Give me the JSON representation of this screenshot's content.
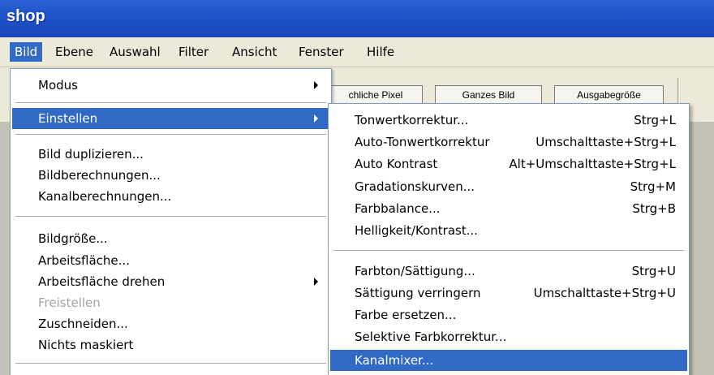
{
  "window": {
    "title": "shop"
  },
  "menubar": [
    {
      "label": "Bild",
      "active": true
    },
    {
      "label": "Ebene"
    },
    {
      "label": "Auswahl"
    },
    {
      "label": "Filter"
    },
    {
      "label": "Ansicht"
    },
    {
      "label": "Fenster"
    },
    {
      "label": "Hilfe"
    }
  ],
  "options_bar": {
    "buttons": [
      "chliche Pixel",
      "Ganzes Bild",
      "Ausgabegröße"
    ]
  },
  "bild_menu": {
    "items": [
      {
        "label": "Modus",
        "submenu": true
      },
      {
        "label": "Einstellen",
        "submenu": true,
        "selected": true
      },
      {
        "label": "Bild duplizieren..."
      },
      {
        "label": "Bildberechnungen..."
      },
      {
        "label": "Kanalberechnungen..."
      },
      {
        "label": "Bildgröße..."
      },
      {
        "label": "Arbeitsfläche..."
      },
      {
        "label": "Arbeitsfläche drehen",
        "submenu": true
      },
      {
        "label": "Freistellen",
        "disabled": true
      },
      {
        "label": "Zuschneiden..."
      },
      {
        "label": "Nichts maskiert"
      }
    ]
  },
  "einstellen_menu": {
    "items": [
      {
        "label": "Tonwertkorrektur...",
        "shortcut": "Strg+L"
      },
      {
        "label": "Auto-Tonwertkorrektur",
        "shortcut": "Umschalttaste+Strg+L"
      },
      {
        "label": "Auto Kontrast",
        "shortcut": "Alt+Umschalttaste+Strg+L"
      },
      {
        "label": "Gradationskurven...",
        "shortcut": "Strg+M"
      },
      {
        "label": "Farbbalance...",
        "shortcut": "Strg+B"
      },
      {
        "label": "Helligkeit/Kontrast..."
      },
      {
        "label": "Farbton/Sättigung...",
        "shortcut": "Strg+U"
      },
      {
        "label": "Sättigung verringern",
        "shortcut": "Umschalttaste+Strg+U"
      },
      {
        "label": "Farbe ersetzen..."
      },
      {
        "label": "Selektive Farbkorrektur..."
      },
      {
        "label": "Kanalmixer...",
        "selected": true
      }
    ]
  },
  "colors": {
    "titlebar": "#1f52c8",
    "highlight": "#316ac5",
    "face": "#ece9d8"
  }
}
